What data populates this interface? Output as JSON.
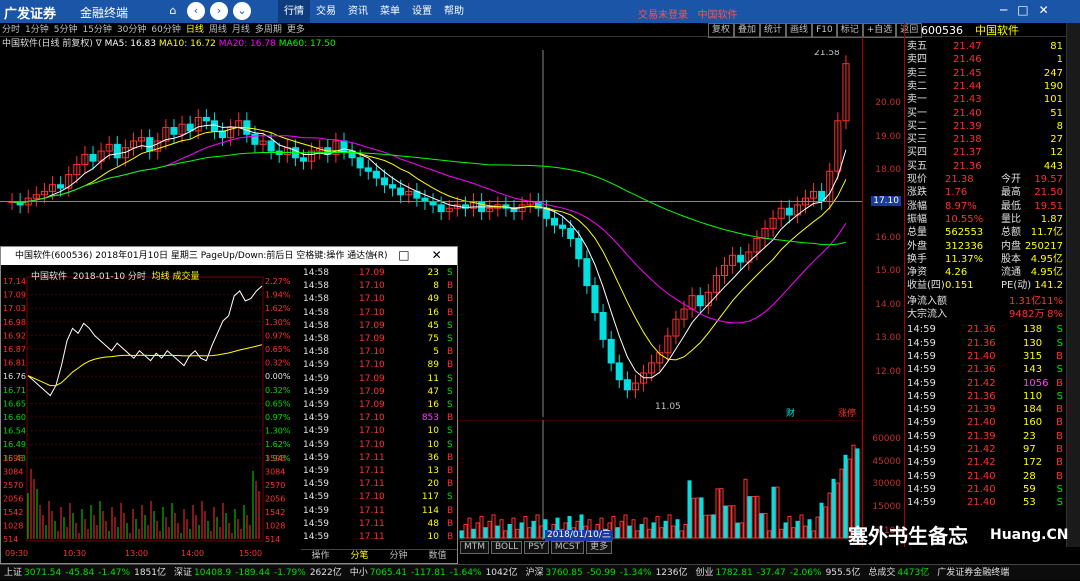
{
  "titlebar": {
    "logo": "广发证券",
    "app_name": "金融终端",
    "menu": [
      "行情",
      "交易",
      "资讯",
      "菜单",
      "设置",
      "帮助"
    ],
    "active_menu": "行情",
    "trade_status": "交易未登录",
    "stock_name": "中国软件"
  },
  "periods": [
    "分时",
    "1分钟",
    "5分钟",
    "15分钟",
    "30分钟",
    "60分钟",
    "日线",
    "周线",
    "月线",
    "多周期",
    "更多"
  ],
  "selected_period": "日线",
  "tools": [
    "复权",
    "叠加",
    "统计",
    "画线",
    "F10",
    "标记",
    "+自选",
    "返回"
  ],
  "info": {
    "title": "中国软件(日线 前复权)",
    "ma5": "MA5: 16.83",
    "ma10": "MA10: 16.72",
    "ma20": "MA20: 16.78",
    "ma60": "MA60: 17.50"
  },
  "main_chart": {
    "high_label": "21.58",
    "low_label": "11.05",
    "cursor_price": "17.10",
    "yaxis_ticks": [
      "20.00",
      "19.00",
      "18.00",
      "17.00",
      "16.00",
      "15.00",
      "14.00",
      "13.00",
      "12.00"
    ],
    "markers": [
      "财",
      "涨停"
    ],
    "colors": {
      "up": "#ff3030",
      "down": "#00e0e0",
      "ma5": "#ffffff",
      "ma10": "#ffff00",
      "ma20": "#ff00ff",
      "ma60": "#00ff00"
    }
  },
  "vol_axis": [
    "60000",
    "45000",
    "30000",
    "15000",
    "X100"
  ],
  "cursor_date": "2018/01/10/三",
  "indicator_tabs": [
    "MTM",
    "BOLL",
    "PSY",
    "MCST",
    "更多"
  ],
  "quote": {
    "code": "600536",
    "name": "中国软件",
    "sell": [
      {
        "label": "卖五",
        "price": "21.47",
        "vol": "81"
      },
      {
        "label": "卖四",
        "price": "21.46",
        "vol": "1"
      },
      {
        "label": "卖三",
        "price": "21.45",
        "vol": "247"
      },
      {
        "label": "卖二",
        "price": "21.44",
        "vol": "190"
      },
      {
        "label": "卖一",
        "price": "21.43",
        "vol": "101"
      }
    ],
    "buy": [
      {
        "label": "买一",
        "price": "21.40",
        "vol": "51"
      },
      {
        "label": "买二",
        "price": "21.39",
        "vol": "8"
      },
      {
        "label": "买三",
        "price": "21.38",
        "vol": "27"
      },
      {
        "label": "买四",
        "price": "21.37",
        "vol": "12"
      },
      {
        "label": "买五",
        "price": "21.36",
        "vol": "443"
      }
    ],
    "stats": [
      {
        "l1": "现价",
        "v1": "21.38",
        "l2": "今开",
        "v2": "19.57"
      },
      {
        "l1": "涨跌",
        "v1": "1.76",
        "l2": "最高",
        "v2": "21.50"
      },
      {
        "l1": "涨幅",
        "v1": "8.97%",
        "l2": "最低",
        "v2": "19.51"
      },
      {
        "l1": "振幅",
        "v1": "10.55%",
        "l2": "量比",
        "v2": "1.87"
      },
      {
        "l1": "总量",
        "v1": "562553",
        "l2": "总额",
        "v2": "11.7亿"
      },
      {
        "l1": "外盘",
        "v1": "312336",
        "l2": "内盘",
        "v2": "250217"
      },
      {
        "l1": "换手",
        "v1": "11.37%",
        "l2": "股本",
        "v2": "4.95亿"
      },
      {
        "l1": "净资",
        "v1": "4.26",
        "l2": "流通",
        "v2": "4.95亿"
      },
      {
        "l1": "收益(四)",
        "v1": "0.151",
        "l2": "PE(动)",
        "v2": "141.2"
      }
    ],
    "flow": [
      {
        "label": "净流入额",
        "value": "1.31亿",
        "pct": "11%"
      },
      {
        "label": "大宗流入",
        "value": "9482万",
        "pct": "8%"
      }
    ],
    "trades": [
      {
        "t": "14:59",
        "p": "21.36",
        "v": "138",
        "f": "S"
      },
      {
        "t": "14:59",
        "p": "21.36",
        "v": "130",
        "f": "S"
      },
      {
        "t": "14:59",
        "p": "21.40",
        "v": "315",
        "f": "B"
      },
      {
        "t": "14:59",
        "p": "21.36",
        "v": "143",
        "f": "S"
      },
      {
        "t": "14:59",
        "p": "21.42",
        "v": "1056",
        "f": "B"
      },
      {
        "t": "14:59",
        "p": "21.36",
        "v": "110",
        "f": "S"
      },
      {
        "t": "14:59",
        "p": "21.39",
        "v": "184",
        "f": "B"
      },
      {
        "t": "14:59",
        "p": "21.40",
        "v": "160",
        "f": "B"
      },
      {
        "t": "14:59",
        "p": "21.39",
        "v": "23",
        "f": "B"
      },
      {
        "t": "14:59",
        "p": "21.42",
        "v": "97",
        "f": "B"
      },
      {
        "t": "14:59",
        "p": "21.42",
        "v": "172",
        "f": "B"
      },
      {
        "t": "14:59",
        "p": "21.40",
        "v": "28",
        "f": "B"
      },
      {
        "t": "14:59",
        "p": "21.40",
        "v": "59",
        "f": "S"
      },
      {
        "t": "14:59",
        "p": "21.40",
        "v": "53",
        "f": "S"
      }
    ]
  },
  "popup": {
    "title": "中国软件(600536) 2018年01月10日 星期三 PageUp/Down:前后日 空格键:操作 通达信(R)",
    "subtitle_name": "中国软件",
    "subtitle_date": "2018-01-10 分时",
    "subtitle_line": "均线",
    "subtitle_vol": "成交量",
    "price_axis": [
      "17.14",
      "17.09",
      "17.03",
      "16.98",
      "16.92",
      "16.87",
      "16.81",
      "16.76",
      "16.71",
      "16.65",
      "16.60",
      "16.54",
      "16.49",
      "16.43"
    ],
    "pct_axis": [
      "2.27%",
      "1.94%",
      "1.62%",
      "1.30%",
      "0.97%",
      "0.65%",
      "0.32%",
      "0.00%",
      "0.32%",
      "0.65%",
      "0.97%",
      "1.30%",
      "1.62%",
      "1.94%"
    ],
    "vol_axis": [
      "3598",
      "3084",
      "2570",
      "2056",
      "1542",
      "1028",
      "514"
    ],
    "time_axis": [
      "09:30",
      "10:30",
      "13:00",
      "14:00",
      "15:00"
    ],
    "ticks": [
      {
        "t": "14:58",
        "p": "17.09",
        "v": "23",
        "f": "S"
      },
      {
        "t": "14:58",
        "p": "17.10",
        "v": "8",
        "f": "B"
      },
      {
        "t": "14:58",
        "p": "17.10",
        "v": "49",
        "f": "B"
      },
      {
        "t": "14:58",
        "p": "17.10",
        "v": "16",
        "f": "B"
      },
      {
        "t": "14:58",
        "p": "17.09",
        "v": "45",
        "f": "S"
      },
      {
        "t": "14:58",
        "p": "17.09",
        "v": "75",
        "f": "S"
      },
      {
        "t": "14:58",
        "p": "17.10",
        "v": "5",
        "f": "B"
      },
      {
        "t": "14:59",
        "p": "17.10",
        "v": "89",
        "f": "B"
      },
      {
        "t": "14:59",
        "p": "17.09",
        "v": "11",
        "f": "S"
      },
      {
        "t": "14:59",
        "p": "17.09",
        "v": "47",
        "f": "S"
      },
      {
        "t": "14:59",
        "p": "17.09",
        "v": "16",
        "f": "S"
      },
      {
        "t": "14:59",
        "p": "17.10",
        "v": "853",
        "f": "B"
      },
      {
        "t": "14:59",
        "p": "17.10",
        "v": "10",
        "f": "S"
      },
      {
        "t": "14:59",
        "p": "17.10",
        "v": "10",
        "f": "S"
      },
      {
        "t": "14:59",
        "p": "17.11",
        "v": "36",
        "f": "B"
      },
      {
        "t": "14:59",
        "p": "17.11",
        "v": "13",
        "f": "B"
      },
      {
        "t": "14:59",
        "p": "17.11",
        "v": "20",
        "f": "B"
      },
      {
        "t": "14:59",
        "p": "17.10",
        "v": "117",
        "f": "S"
      },
      {
        "t": "14:59",
        "p": "17.11",
        "v": "114",
        "f": "B"
      },
      {
        "t": "14:59",
        "p": "17.11",
        "v": "48",
        "f": "B"
      },
      {
        "t": "14:59",
        "p": "17.11",
        "v": "10",
        "f": "B"
      }
    ],
    "tabs": [
      "操作",
      "分笔",
      "分钟",
      "数值"
    ]
  },
  "statusbar": [
    {
      "name": "上证",
      "val": "3071.54",
      "chg": "-45.84",
      "pct": "-1.47%",
      "amt": "1851亿"
    },
    {
      "name": "深证",
      "val": "10408.9",
      "chg": "-189.44",
      "pct": "-1.79%",
      "amt": "2622亿"
    },
    {
      "name": "中小",
      "val": "7065.41",
      "chg": "-117.81",
      "pct": "-1.64%",
      "amt": "1042亿"
    },
    {
      "name": "沪深",
      "val": "3760.85",
      "chg": "-50.99",
      "pct": "-1.34%",
      "amt": "1236亿"
    },
    {
      "name": "创业",
      "val": "1782.81",
      "chg": "-37.47",
      "pct": "-2.06%",
      "amt": "955.5亿"
    },
    {
      "name": "总成交",
      "val": "4473亿",
      "chg": "",
      "pct": "",
      "amt": ""
    }
  ],
  "status_brand": "广发证券金融终端",
  "watermark": "塞外书生备忘",
  "watermark_site": "Huang.CN"
}
